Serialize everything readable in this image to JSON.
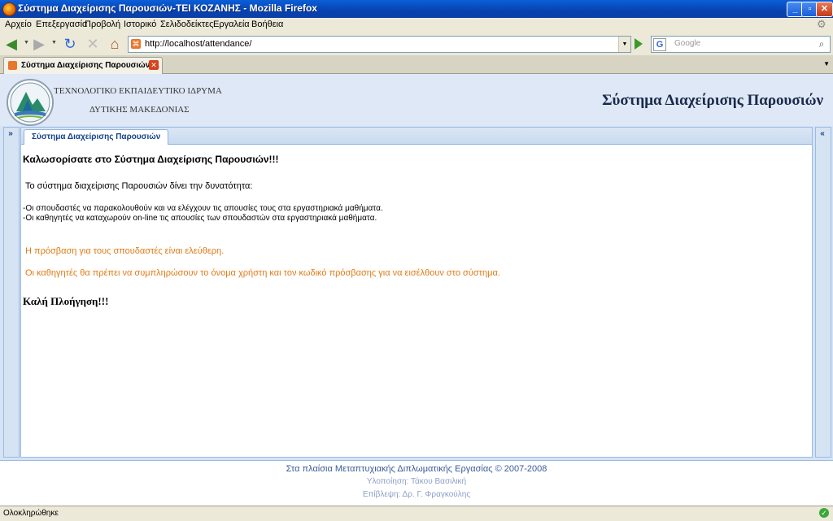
{
  "window": {
    "title": "Σύστημα Διαχείρισης Παρουσιών-ΤΕΙ ΚΟΖΑΝΗΣ - Mozilla Firefox",
    "minimize": "_",
    "maximize": "▫",
    "close": "✕"
  },
  "menu": [
    "Αρχείο",
    "Επεξεργασία",
    "Προβολή",
    "Ιστορικό",
    "Σελιδοδείκτες",
    "Εργαλεία",
    "Βοήθεια"
  ],
  "nav": {
    "back_icon": "◀",
    "forward_icon": "▶",
    "reload_icon": "↻",
    "stop_icon": "✕",
    "home_icon": "⌂",
    "url": "http://localhost/attendance/",
    "search_engine": "G",
    "search_placeholder": "Google"
  },
  "tab": {
    "label": "Σύστημα Διαχείρισης Παρουσιών-..."
  },
  "header": {
    "org_line1": "ΤΕΧΝΟΛΟΓΙΚΟ ΕΚΠΑΙΔΕΥΤΙΚΟ ΙΔΡΥΜΑ",
    "org_line2": "ΔΥΤΙΚΗΣ ΜΑΚΕΔΟΝΙΑΣ",
    "system_name": "Σύστημα Διαχείρισης Παρουσιών"
  },
  "panel": {
    "tab_label": "Σύστημα Διαχείρισης Παρουσιών",
    "left_collapse": "»",
    "right_collapse": "«"
  },
  "content": {
    "welcome": "Καλωσορίσατε στο Σύστημα Διαχείρισης Παρουσιών!!!",
    "intro": "Το σύστημα διαχείρισης Παρουσιών δίνει την δυνατότητα:",
    "bullet1": "-Οι σπουδαστές να παρακολουθούν και να ελέγχουν τις απουσίες τους στα εργαστηριακά μαθήματα.",
    "bullet2": "-Οι καθηγητές να καταχωρούν on-line τις απουσίες των σπουδαστών στα εργαστηριακά μαθήματα.",
    "students_access": "Η πρόσβαση για τους σπουδαστές είναι ελεύθερη.",
    "teachers_access": "Οι καθηγητές θα πρέπει να συμπληρώσουν το όνομα χρήστη και τον κωδικό πρόσβασης για να εισέλθουν στο σύστημα.",
    "goodbye": "Καλή Πλοήγηση!!!"
  },
  "footer": {
    "line1": "Στα πλαίσια Μεταπτυχιακής Διπλωματικής Εργασίας © 2007-2008",
    "line2": "Υλοποίηση: Τάκου Βασιλική",
    "line3": "Επίβλεψη: Δρ. Γ. Φραγκούλης"
  },
  "status": {
    "text": "Ολοκληρώθηκε"
  },
  "colors": {
    "orange_text": "#e07a14",
    "title_bar": "#0a5fd8",
    "panel_border": "#99bbe8"
  }
}
